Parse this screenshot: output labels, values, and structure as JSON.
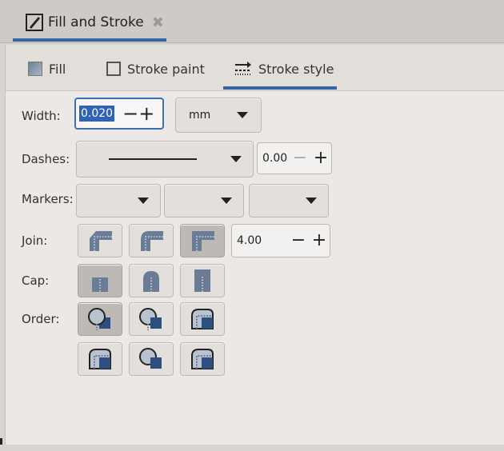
{
  "window": {
    "tab_title": "Fill and Stroke",
    "tab_close": "✖"
  },
  "subtabs": [
    {
      "label": "Fill",
      "icon": "fill-swatch-icon"
    },
    {
      "label": "Stroke paint",
      "icon": "stroke-swatch-icon"
    },
    {
      "label": "Stroke style",
      "icon": "stroke-style-icon",
      "active": true
    }
  ],
  "accent_color": "#3465a4",
  "selection_color": "#2f63b5",
  "labels": {
    "width": "Width:",
    "dashes": "Dashes:",
    "markers": "Markers:",
    "join": "Join:",
    "cap": "Cap:",
    "order": "Order:"
  },
  "width": {
    "value": "0.020",
    "minus": "−",
    "plus": "+",
    "unit": "mm"
  },
  "dashes": {
    "offset_value": "0.00",
    "minus": "−",
    "plus": "+"
  },
  "join": {
    "miter_limit": "4.00",
    "minus": "−",
    "plus": "+",
    "buttons": [
      "join-bevel-icon",
      "join-round-icon",
      "join-miter-icon"
    ],
    "selected": "join-miter-icon"
  },
  "cap": {
    "buttons": [
      "cap-butt-icon",
      "cap-round-icon",
      "cap-square-icon"
    ],
    "selected": "cap-butt-icon"
  },
  "order": {
    "buttons": [
      "order-fill-stroke-markers-icon",
      "order-stroke-fill-markers-icon",
      "order-fill-markers-stroke-icon",
      "order-markers-fill-stroke-icon",
      "order-stroke-markers-fill-icon",
      "order-markers-stroke-fill-icon"
    ],
    "selected": "order-fill-stroke-markers-icon"
  }
}
